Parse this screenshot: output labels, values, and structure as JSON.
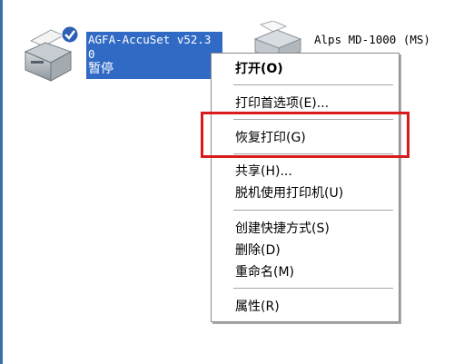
{
  "printers": [
    {
      "name_line1": "AGFA-AccuSet v52.3",
      "name_line2": "0",
      "status": "暂停",
      "icon": "printer-icon",
      "badge_icon": "check-icon"
    },
    {
      "name_line1": "Alps MD-1000 (MS)",
      "icon": "printer-icon"
    }
  ],
  "context_menu": {
    "open": "打开(O)",
    "printing_preferences": "打印首选项(E)...",
    "resume_printing": "恢复打印(G)",
    "sharing": "共享(H)...",
    "use_offline": "脱机使用打印机(U)",
    "create_shortcut": "创建快捷方式(S)",
    "delete": "删除(D)",
    "rename": "重命名(M)",
    "properties": "属性(R)"
  },
  "colors": {
    "selection": "#316ac5",
    "highlight_box": "#d91b1b",
    "desktop_strip": "#3a6ea5"
  }
}
